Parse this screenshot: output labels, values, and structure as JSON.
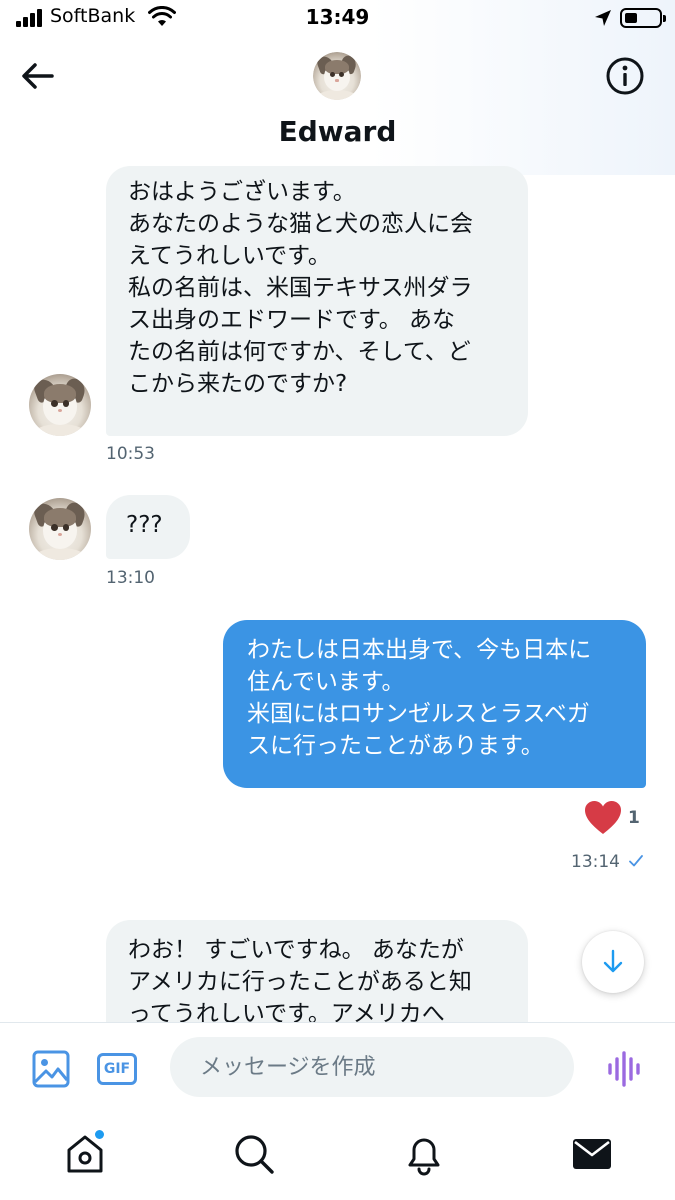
{
  "status_bar": {
    "carrier": "SoftBank",
    "time": "13:49"
  },
  "header": {
    "contact_name": "Edward",
    "avatar": "cat-avatar",
    "back_icon": "back-arrow-icon",
    "info_icon": "info-icon"
  },
  "messages": [
    {
      "direction": "incoming",
      "lines": [
        "おはようございます。",
        "あなたのような猫と犬の恋人に会",
        "えてうれしいです。",
        "私の名前は、米国テキサス州ダラ",
        "ス出身のエドワードです。 あな",
        "たの名前は何ですか、そして、ど",
        "こから来たのですか?"
      ],
      "time": "10:53"
    },
    {
      "direction": "incoming",
      "lines": [
        "???"
      ],
      "time": "13:10"
    },
    {
      "direction": "outgoing",
      "lines": [
        "わたしは日本出身で、今も日本に",
        "住んでいます。",
        "米国にはロサンゼルスとラスベガ",
        "スに行ったことがあります。"
      ],
      "reaction_count": "1",
      "time": "13:14",
      "read": true
    },
    {
      "direction": "incoming",
      "lines": [
        "わお！ すごいですね。 あなたが",
        "アメリカに行ったことがあると知",
        "ってうれしいです。アメリカへ"
      ]
    }
  ],
  "composer": {
    "placeholder": "メッセージを作成",
    "media_icon": "image-icon",
    "gif_label": "GIF",
    "voice_icon": "voice-message-icon"
  },
  "tabbar": {
    "items": [
      "home",
      "search",
      "notifications",
      "messages"
    ],
    "active": "messages"
  },
  "colors": {
    "accent": "#1d9bf0",
    "outgoing_bubble": "#3b94e4",
    "incoming_bubble": "#eff3f4",
    "heart": "#d63b46",
    "voice": "#9b6ae0"
  }
}
